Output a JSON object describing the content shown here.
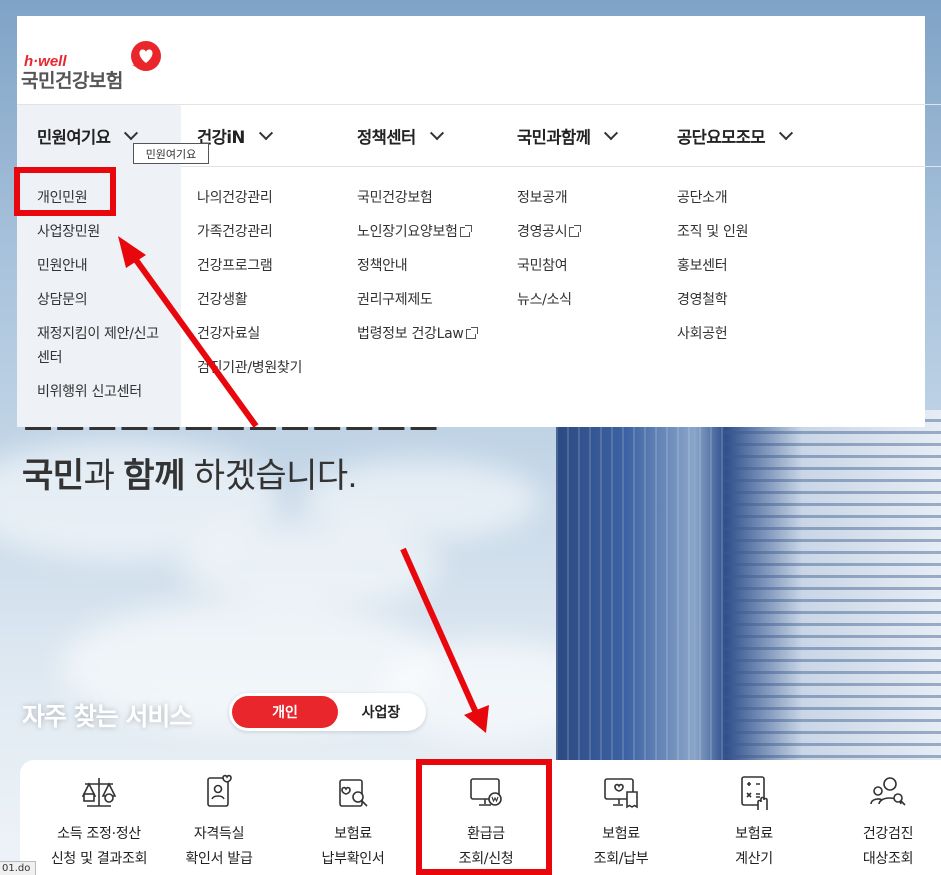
{
  "brand": {
    "logo_small": "h·well",
    "logo_big": "국민건강보험",
    "accent": "#e8262b"
  },
  "nav": {
    "items": [
      {
        "label": "민원여기요"
      },
      {
        "label": "건강iN"
      },
      {
        "label": "정책센터"
      },
      {
        "label": "국민과함께"
      },
      {
        "label": "공단요모조모"
      }
    ],
    "tooltip": "민원여기요"
  },
  "menu": {
    "col1": [
      "개인민원",
      "사업장민원",
      "민원안내",
      "상담문의",
      "재정지킴이 제안/신고",
      "센터",
      "비위행위 신고센터"
    ],
    "col2": [
      "나의건강관리",
      "가족건강관리",
      "건강프로그램",
      "건강생활",
      "건강자료실",
      "검진기관/병원찾기"
    ],
    "col3": [
      "국민건강보험",
      "노인장기요양보험",
      "정책안내",
      "권리구제제도",
      "법령정보 건강Law"
    ],
    "col4": [
      "정보공개",
      "경영공시",
      "국민참여",
      "뉴스/소식"
    ],
    "col5": [
      "공단소개",
      "조직 및 인원",
      "홍보센터",
      "경영철학",
      "사회공헌"
    ]
  },
  "hero": {
    "line2_bold1": "국민",
    "line2_mid1": "과 ",
    "line2_bold2": "함께",
    "line2_rest": " 하겠습니다."
  },
  "frequent": {
    "title": "자주 찾는 서비스",
    "toggle_on": "개인",
    "toggle_off": "사업장",
    "services": [
      {
        "line1": "소득 조정·정산",
        "line2": "신청 및 결과조회",
        "icon": "scale-icon"
      },
      {
        "line1": "자격득실",
        "line2": "확인서 발급",
        "icon": "id-card-heart-icon"
      },
      {
        "line1": "보험료",
        "line2": "납부확인서",
        "icon": "document-search-icon"
      },
      {
        "line1": "환급금",
        "line2": "조회/신청",
        "icon": "monitor-coin-icon"
      },
      {
        "line1": "보험료",
        "line2": "조회/납부",
        "icon": "monitor-heart-receipt-icon"
      },
      {
        "line1": "보험료",
        "line2": "계산기",
        "icon": "calculator-hand-icon"
      },
      {
        "line1": "건강검진",
        "line2": "대상조회",
        "icon": "people-search-icon"
      }
    ]
  },
  "status": {
    "text": "01.do"
  }
}
